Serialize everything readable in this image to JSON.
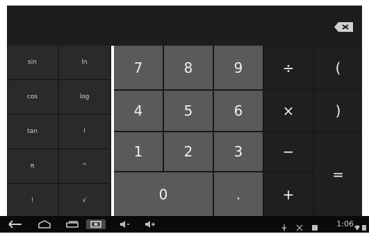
{
  "display": {
    "value": ""
  },
  "advanced_keys": [
    {
      "label": "sin"
    },
    {
      "label": "ln"
    },
    {
      "label": "cos"
    },
    {
      "label": "log"
    },
    {
      "label": "tan"
    },
    {
      "label": "!"
    },
    {
      "label": "π"
    },
    {
      "label": "^"
    },
    {
      "label": "!"
    },
    {
      "label": "√"
    }
  ],
  "keys": {
    "k7": "7",
    "k8": "8",
    "k9": "9",
    "div": "÷",
    "lparen": "(",
    "k4": "4",
    "k5": "5",
    "k6": "6",
    "mul": "×",
    "rparen": ")",
    "k1": "1",
    "k2": "2",
    "k3": "3",
    "minus": "−",
    "k0": "0",
    "dot": ".",
    "plus": "+",
    "equals": "="
  },
  "status": {
    "time": "1:06"
  },
  "icons": {
    "backspace": "backspace-icon",
    "nav": [
      "back-icon",
      "home-icon",
      "recent-apps-icon",
      "screenshot-icon",
      "volume-down-icon",
      "volume-up-icon"
    ],
    "status": [
      "usb-icon",
      "debug-icon",
      "gallery-icon",
      "wifi-icon",
      "battery-icon"
    ]
  }
}
